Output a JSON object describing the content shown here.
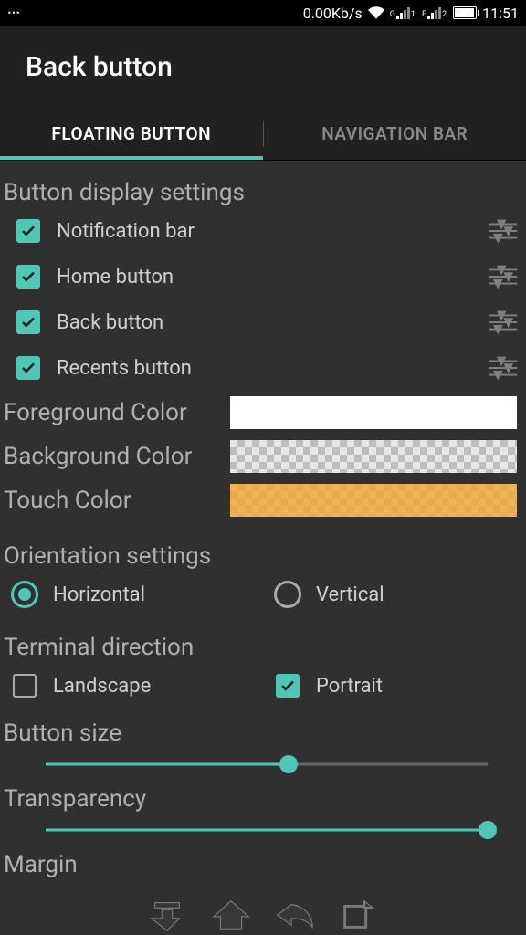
{
  "status": {
    "speed": "0.00Kb/s",
    "time": "11:51",
    "net_g": "G",
    "net_e": "E",
    "sim1_sub": "1",
    "sim2_sub": "2"
  },
  "header": {
    "title": "Back button"
  },
  "tabs": {
    "floating": "FLOATING BUTTON",
    "navbar": "NAVIGATION BAR"
  },
  "sections": {
    "button_display": "Button display settings",
    "orientation": "Orientation settings",
    "terminal_direction": "Terminal direction",
    "button_size": "Button size",
    "transparency": "Transparency",
    "margin": "Margin"
  },
  "checks": {
    "notification_bar": "Notification bar",
    "home_button": "Home button",
    "back_button": "Back button",
    "recents_button": "Recents button"
  },
  "colors": {
    "foreground_label": "Foreground Color",
    "background_label": "Background Color",
    "touch_label": "Touch Color",
    "foreground_value": "#ffffff",
    "background_value": "transparent",
    "touch_value": "#f0a93a"
  },
  "orientation": {
    "horizontal": "Horizontal",
    "vertical": "Vertical",
    "selected": "horizontal"
  },
  "terminal": {
    "landscape": "Landscape",
    "portrait": "Portrait",
    "landscape_checked": false,
    "portrait_checked": true
  },
  "sliders": {
    "button_size_percent": 55,
    "transparency_percent": 100
  }
}
